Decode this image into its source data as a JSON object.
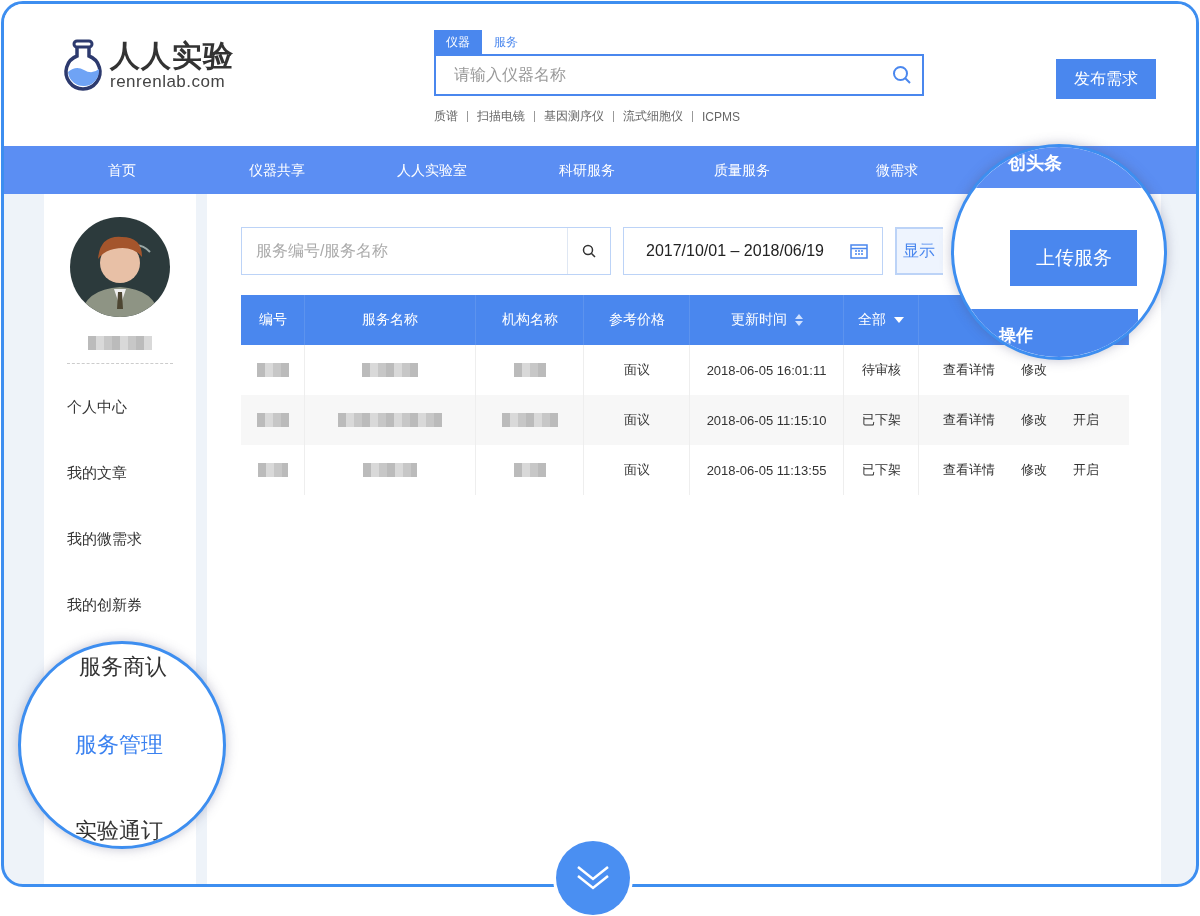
{
  "header": {
    "logo": {
      "name": "人人实验",
      "domain": "renrenlab.com"
    },
    "search": {
      "tabs": [
        {
          "label": "仪器",
          "selected": true
        },
        {
          "label": "服务",
          "selected": false
        }
      ],
      "placeholder": "请输入仪器名称",
      "hot": [
        "质谱",
        "扫描电镜",
        "基因测序仪",
        "流式细胞仪",
        "ICPMS"
      ]
    },
    "publish_button": "发布需求"
  },
  "nav": [
    {
      "label": "首页"
    },
    {
      "label": "仪器共享"
    },
    {
      "label": "人人实验室"
    },
    {
      "label": "科研服务"
    },
    {
      "label": "质量服务"
    },
    {
      "label": "微需求"
    }
  ],
  "sidebar": {
    "user": {
      "name": {
        "kind": "redacted"
      }
    },
    "items": [
      {
        "label": "个人中心"
      },
      {
        "label": "我的文章"
      },
      {
        "label": "我的微需求"
      },
      {
        "label": "我的创新券"
      }
    ]
  },
  "toolbar": {
    "search": {
      "placeholder": "服务编号/服务名称"
    },
    "date_range": "2017/10/01 – 2018/06/19",
    "show_button": "显示"
  },
  "table": {
    "columns": [
      {
        "label": "编号",
        "kind": "plain"
      },
      {
        "label": "服务名称",
        "kind": "plain"
      },
      {
        "label": "机构名称",
        "kind": "plain"
      },
      {
        "label": "参考价格",
        "kind": "plain"
      },
      {
        "label": "更新时间",
        "kind": "sort"
      },
      {
        "label": "全部",
        "kind": "filter"
      }
    ],
    "rows": [
      {
        "cells": [
          {
            "kind": "redacted"
          },
          {
            "kind": "redacted"
          },
          {
            "kind": "redacted"
          },
          {
            "kind": "text",
            "text": "面议"
          },
          {
            "kind": "text",
            "text": "2018-06-05 16:01:11"
          },
          {
            "kind": "text",
            "text": "待审核"
          }
        ],
        "actions": [
          "查看详情",
          "修改"
        ]
      },
      {
        "cells": [
          {
            "kind": "redacted"
          },
          {
            "kind": "redacted"
          },
          {
            "kind": "redacted"
          },
          {
            "kind": "text",
            "text": "面议"
          },
          {
            "kind": "text",
            "text": "2018-06-05 11:15:10"
          },
          {
            "kind": "text",
            "text": "已下架"
          }
        ],
        "actions": [
          "查看详情",
          "修改",
          "开启"
        ]
      },
      {
        "cells": [
          {
            "kind": "redacted"
          },
          {
            "kind": "redacted"
          },
          {
            "kind": "redacted"
          },
          {
            "kind": "text",
            "text": "面议"
          },
          {
            "kind": "text",
            "text": "2018-06-05 11:13:55"
          },
          {
            "kind": "text",
            "text": "已下架"
          }
        ],
        "actions": [
          "查看详情",
          "修改",
          "开启"
        ]
      }
    ]
  },
  "magnifiers": [
    {
      "kind": "toolbar",
      "nav_label": "创头条",
      "button": "上传服务",
      "column": "操作"
    },
    {
      "kind": "sidebar",
      "items": [
        {
          "label": "服务商认",
          "selected": false
        },
        {
          "label": "服务管理",
          "selected": true
        },
        {
          "label": "实验通订",
          "selected": false
        }
      ]
    }
  ]
}
